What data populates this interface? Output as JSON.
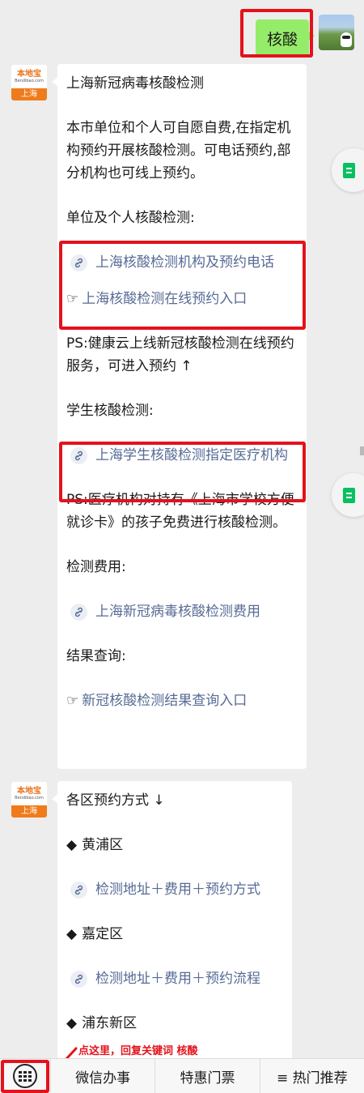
{
  "outgoing": {
    "text": "核酸"
  },
  "bot": {
    "brand": "本地宝",
    "domain": "Bendibao.com",
    "city": "上海"
  },
  "message1": {
    "title": "上海新冠病毒核酸检测",
    "intro": "本市单位和个人可自愿自费,在指定机构预约开展核酸检测。可电话预约,部分机构也可线上预约。",
    "section1": "单位及个人核酸检测:",
    "link1": "上海核酸检测机构及预约电话",
    "hand": "☞",
    "link2": "上海核酸检测在线预约入口",
    "ps1": "PS:健康云上线新冠核酸检测在线预约服务，可进入预约 ↑",
    "section2": "学生核酸检测:",
    "link3": "上海学生核酸检测指定医疗机构",
    "ps2": "PS:医疗机构对持有《上海市学校方便就诊卡》的孩子免费进行核酸检测。",
    "section3": "检测费用:",
    "link4": "上海新冠病毒核酸检测费用",
    "section4": "结果查询:",
    "link5": "新冠核酸检测结果查询入口"
  },
  "message2": {
    "header": "各区预约方式 ↓",
    "diamond": "◆",
    "district1": "黄浦区",
    "link1": "检测地址＋费用＋预约方式",
    "district2": "嘉定区",
    "link2": "检测地址＋费用＋预约流程",
    "district3": "浦东新区"
  },
  "hint": "点这里，回复关键词 核酸",
  "bottom_menu": {
    "item1": "微信办事",
    "item2": "特惠门票",
    "item3": "≡ 热门推荐"
  },
  "colors": {
    "bubble_out": "#95ec69",
    "link": "#576b95",
    "highlight": "#e3121b",
    "brand_orange": "#f07b1c"
  }
}
